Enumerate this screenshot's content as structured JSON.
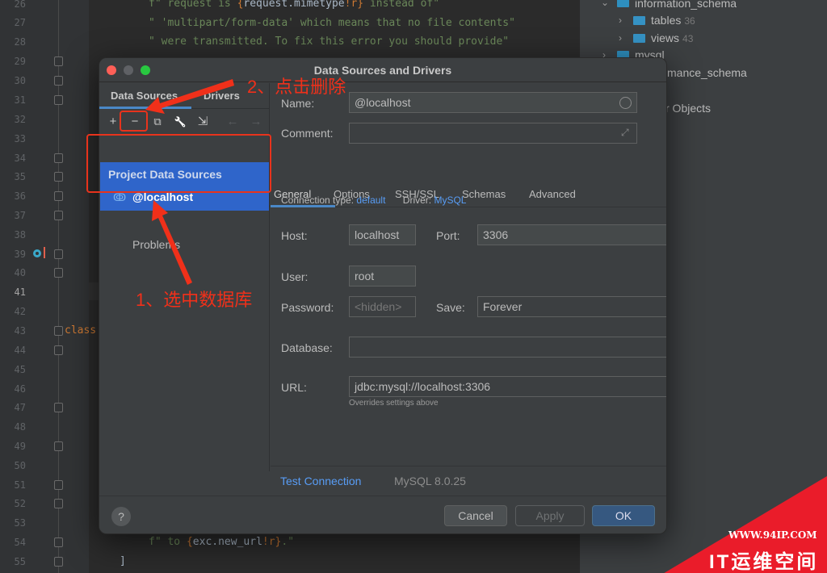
{
  "editor": {
    "line_numbers": [
      "26",
      "27",
      "28",
      "29",
      "30",
      "31",
      "32",
      "33",
      "34",
      "35",
      "36",
      "37",
      "38",
      "39",
      "40",
      "41",
      "42",
      "43",
      "44",
      "45",
      "46",
      "47",
      "48",
      "49",
      "50",
      "51",
      "52",
      "53",
      "54",
      "55"
    ],
    "current_line": "41",
    "code": {
      "line26": {
        "a": "f\" request is ",
        "b": "{",
        "c": "request.mimetype",
        "d": "!r}",
        "e": " instead of\""
      },
      "line27": "\" 'multipart/form-data' which means that no file contents\"",
      "line28": "\" were transmitted. To fix this error you should provide\"",
      "line43": "class",
      "line54": {
        "a": "f\" to ",
        "b": "{",
        "c": "exc.new_url",
        "d": "!r}",
        "e": ".\""
      },
      "line55": "]"
    }
  },
  "db_tree": {
    "items": [
      {
        "label": "information_schema"
      },
      {
        "label": "tables",
        "count": "36"
      },
      {
        "label": "views",
        "count": "43"
      },
      {
        "label": "mysql"
      },
      {
        "label": "mance_schema"
      },
      {
        "label": "r Objects"
      }
    ]
  },
  "dialog": {
    "title": "Data Sources and Drivers",
    "left_tabs": [
      "Data Sources",
      "Drivers"
    ],
    "toolbar": {
      "add": "+",
      "remove": "−",
      "duplicate": "⧉",
      "settings": "🔧",
      "import": "⇲",
      "back": "←",
      "forward": "→"
    },
    "group_label": "Project Data Sources",
    "selected_source": "@localhost",
    "problems_label": "Problems",
    "name_label": "Name:",
    "name_value": "@localhost",
    "comment_label": "Comment:",
    "comment_value": "",
    "tabs": [
      "General",
      "Options",
      "SSH/SSL",
      "Schemas",
      "Advanced"
    ],
    "active_tab": "General",
    "connection_type_label": "Connection type:",
    "connection_type_value": "default",
    "driver_label": "Driver:",
    "driver_value": "MySQL",
    "host_label": "Host:",
    "host_value": "localhost",
    "port_label": "Port:",
    "port_value": "3306",
    "user_label": "User:",
    "user_value": "root",
    "password_label": "Password:",
    "password_placeholder": "<hidden>",
    "save_label": "Save:",
    "save_value": "Forever",
    "database_label": "Database:",
    "database_value": "",
    "url_label": "URL:",
    "url_value": "jdbc:mysql://localhost:3306",
    "url_hint": "Overrides settings above",
    "test_connection": "Test Connection",
    "server_version": "MySQL 8.0.25",
    "help": "?",
    "cancel": "Cancel",
    "apply": "Apply",
    "ok": "OK"
  },
  "annotations": {
    "step2": "2、点击删除",
    "step1": "1、选中数据库"
  },
  "watermark": {
    "url": "WWW.94IP.COM",
    "name": "IT运维空间"
  },
  "colors": {
    "accent_red": "#e8331c",
    "selection_blue": "#2f65ca",
    "link_blue": "#589df6",
    "ok_blue": "#365880"
  }
}
